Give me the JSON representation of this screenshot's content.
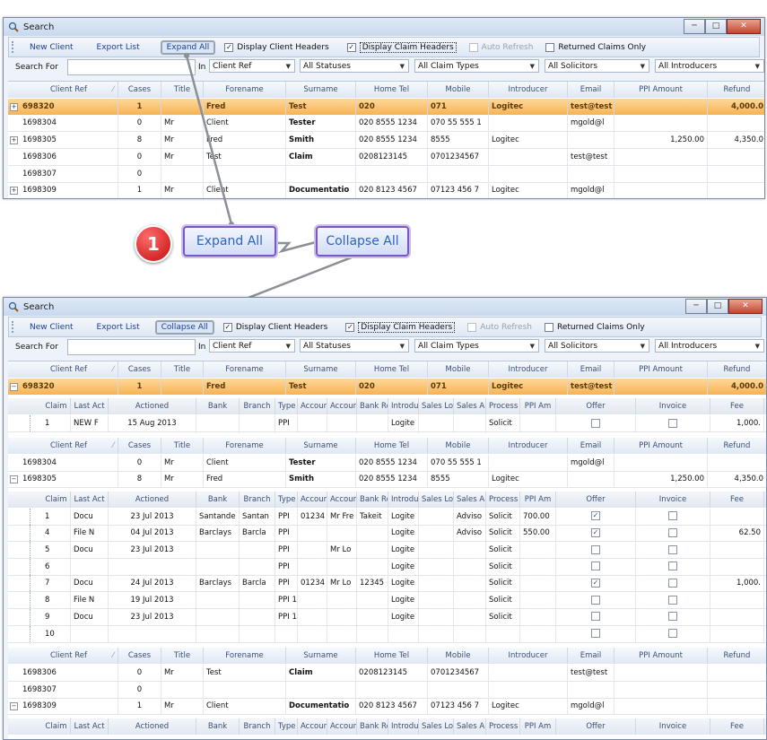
{
  "window": {
    "title": "Search",
    "min": "─",
    "max": "□",
    "close": "✕"
  },
  "toolbar_top": {
    "new_client": "New Client",
    "export_list": "Export List",
    "toggle": "Expand All"
  },
  "toolbar_bottom": {
    "new_client": "New Client",
    "export_list": "Export List",
    "toggle": "Collapse All"
  },
  "options": {
    "display_client_headers": "Display Client Headers",
    "display_claim_headers": "Display Claim Headers",
    "auto_refresh": "Auto Refresh",
    "returned_claims_only": "Returned Claims Only"
  },
  "filters": {
    "search_for": "Search For",
    "in": "In",
    "field": "Client Ref",
    "status": "All Statuses",
    "claim_types": "All Claim Types",
    "solicitors": "All Solicitors",
    "introducers": "All Introducers"
  },
  "client_headers": [
    "Client Ref",
    "Cases",
    "Title",
    "Forename",
    "Surname",
    "Home Tel",
    "Mobile",
    "Introducer",
    "Email",
    "PPI Amount",
    "Refund"
  ],
  "claim_headers": [
    "Claim",
    "Last Act",
    "Actioned",
    "Bank",
    "Branch",
    "Type",
    "Accoun",
    "Accoun",
    "Bank Re",
    "Introdu",
    "Sales Lo",
    "Sales A",
    "Process",
    "PPI Am",
    "Offer",
    "Invoice",
    "Fee"
  ],
  "top_rows": [
    [
      "698320",
      "1",
      "",
      "Fred",
      "Test",
      "020",
      "071",
      "Logitec",
      "test@test",
      "",
      "4,000.0"
    ],
    [
      "1698304",
      "0",
      "Mr",
      "Client",
      "Tester",
      "020 8555 1234",
      "070 55 555 1",
      "",
      "mgold@l",
      "",
      ""
    ],
    [
      "1698305",
      "8",
      "Mr",
      "Fred",
      "Smith",
      "020 8555 1234",
      "8555",
      "Logitec",
      "",
      "1,250.00",
      "4,350.0"
    ],
    [
      "1698306",
      "0",
      "Mr",
      "Test",
      "Claim",
      "0208123145",
      "0701234567",
      "",
      "test@test",
      "",
      ""
    ],
    [
      "1698307",
      "0",
      "",
      "",
      "",
      "",
      "",
      "",
      "",
      "",
      ""
    ],
    [
      "1698309",
      "1",
      "Mr",
      "Client",
      "Documentatio",
      "020 8123 4567",
      "07123 456 7",
      "Logitec",
      "mgold@l",
      "",
      ""
    ]
  ],
  "bottom_first": [
    "698320",
    "1",
    "",
    "Fred",
    "Test",
    "020",
    "071",
    "Logitec",
    "test@test",
    "",
    "4,000.0"
  ],
  "claims_698320": [
    [
      "1",
      "NEW F",
      "15 Aug 2013",
      "",
      "",
      "PPI",
      "",
      "",
      "",
      "Logite",
      "",
      "",
      "Solicit",
      "",
      "☐",
      "☐",
      "1,000."
    ]
  ],
  "bottom_mid": [
    [
      "1698304",
      "0",
      "Mr",
      "Client",
      "Tester",
      "020 8555 1234",
      "070 55 555 1",
      "",
      "mgold@l",
      "",
      ""
    ],
    [
      "1698305",
      "8",
      "Mr",
      "Fred",
      "Smith",
      "020 8555 1234",
      "8555",
      "Logitec",
      "",
      "1,250.00",
      "4,350.0"
    ]
  ],
  "claims_1698305": [
    [
      "1",
      "Docu",
      "23 Jul 2013",
      "Santande",
      "Santan",
      "PPI",
      "01234",
      "Mr Fre",
      "Takeit",
      "Logite",
      "",
      "Adviso",
      "Solicit",
      "700.00",
      "☑",
      "☐",
      ""
    ],
    [
      "4",
      "File N",
      "04 Jul 2013",
      "Barclays",
      "Barcla",
      "PPI",
      "",
      "",
      "",
      "Logite",
      "",
      "Adviso",
      "Solicit",
      "550.00",
      "☑",
      "☐",
      "62.50"
    ],
    [
      "5",
      "Docu",
      "23 Jul 2013",
      "",
      "",
      "PPI",
      "",
      "Mr Lo",
      "",
      "Logite",
      "",
      "",
      "Solicit",
      "",
      "☐",
      "☐",
      ""
    ],
    [
      "6",
      "",
      "",
      "",
      "",
      "PPI",
      "",
      "",
      "",
      "Logite",
      "",
      "",
      "Solicit",
      "",
      "☐",
      "☐",
      ""
    ],
    [
      "7",
      "Docu",
      "24 Jul 2013",
      "Barclays",
      "Barcla",
      "PPI",
      "01234",
      "Mr Lo",
      "12345",
      "Logite",
      "",
      "",
      "Solicit",
      "",
      "☑",
      "☐",
      "1,000."
    ],
    [
      "8",
      "File N",
      "19 Jul 2013",
      "",
      "",
      "PPI 1",
      "",
      "",
      "",
      "Logite",
      "",
      "",
      "Solicit",
      "",
      "☐",
      "☐",
      ""
    ],
    [
      "9",
      "Docu",
      "23 Jul 2013",
      "",
      "",
      "PPI 1",
      "",
      "",
      "",
      "Logite",
      "",
      "",
      "Solicit",
      "",
      "☐",
      "☐",
      ""
    ],
    [
      "10",
      "",
      "",
      "",
      "",
      "",
      "",
      "",
      "",
      "",
      "",
      "",
      "",
      "",
      "☐",
      "☐",
      ""
    ]
  ],
  "bottom_tail": [
    [
      "1698306",
      "0",
      "Mr",
      "Test",
      "Claim",
      "0208123145",
      "0701234567",
      "",
      "test@test",
      "",
      ""
    ],
    [
      "1698307",
      "0",
      "",
      "",
      "",
      "",
      "",
      "",
      "",
      "",
      ""
    ],
    [
      "1698309",
      "1",
      "Mr",
      "Client",
      "Documentatio",
      "020 8123 4567",
      "07123 456 7",
      "Logitec",
      "mgold@l",
      "",
      ""
    ]
  ],
  "callouts": {
    "step": "1",
    "expand": "Expand All",
    "collapse": "Collapse All"
  },
  "expander": {
    "plus": "+",
    "minus": "−"
  },
  "checkmark": "✓",
  "dropdown_arrow": "▼",
  "sort_arrow": "⁄"
}
